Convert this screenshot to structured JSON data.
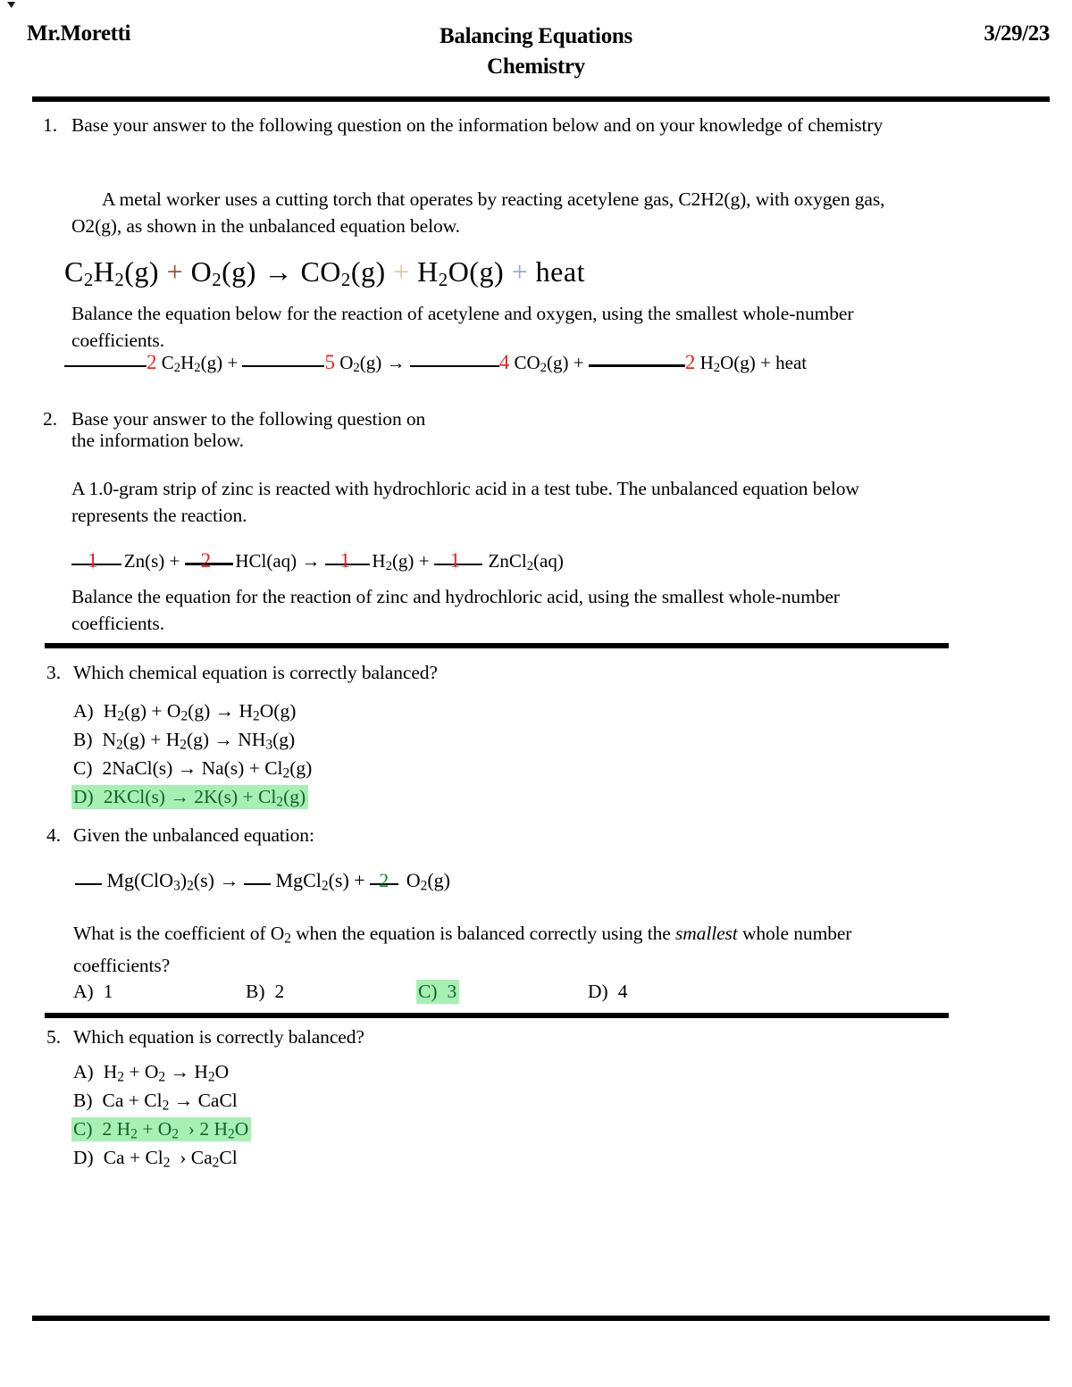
{
  "header": {
    "teacher": "Mr.Moretti",
    "title_line1": "Balancing Equations",
    "title_line2": "Chemistry",
    "date": "3/29/23"
  },
  "colors": {
    "highlight_green": "#a6f0b4",
    "highlight_text_green": "#13632a",
    "handwriting_red": "#e8221c",
    "handwriting_green": "#0a8a2a",
    "rule_black": "#000000"
  },
  "questions": [
    {
      "number": "1.",
      "stem": "Base your answer to the following question on the information below and on your knowledge of chemistry",
      "passage": "A metal worker uses a cutting torch that operates by reacting acetylene gas, C2H2(g), with oxygen gas, O2(g), as shown in the unbalanced equation below.",
      "display_equation": {
        "reactant1": "C2H2(g)",
        "plus1": "+",
        "reactant2": "O2(g)",
        "arrow": "→",
        "product1": "CO2(g)",
        "plus2": "+",
        "product2": "H2O(g)",
        "plus3": "+",
        "product3": "heat"
      },
      "instruction": "Balance the equation below for the reaction of acetylene and oxygen, using the smallest whole-number coefficients.",
      "fill_equation": {
        "terms": [
          {
            "answer": "2",
            "formula": "C2H2(g)"
          },
          {
            "answer": "5",
            "formula": "O2(g)"
          },
          {
            "answer": "4",
            "formula": "CO2(g)"
          },
          {
            "answer": "2",
            "formula": "H2O(g)"
          }
        ],
        "operator1": "+",
        "arrow": "→",
        "operator2": "+",
        "trailing": "+ heat"
      }
    },
    {
      "number": "2.",
      "stem_line1": "Base your answer to the following question on",
      "stem_line2": "the information below.",
      "passage": "A 1.0-gram strip of zinc is reacted with hydrochloric acid in a test tube. The unbalanced equation below represents the reaction.",
      "fill_equation": {
        "terms": [
          {
            "answer": "1",
            "formula": "Zn(s)"
          },
          {
            "answer": "2",
            "formula": "HCl(aq)"
          },
          {
            "answer": "1",
            "formula": "H2(g)"
          },
          {
            "answer": "1",
            "formula": "ZnCl2(aq)"
          }
        ],
        "operator1": "+",
        "arrow": "→",
        "operator2": "+"
      },
      "instruction": "Balance the equation for the reaction of zinc and hydrochloric acid, using the smallest whole-number coefficients."
    },
    {
      "number": "3.",
      "prompt": "Which chemical equation is correctly balanced?",
      "choices": [
        {
          "label": "A)",
          "text": "H2(g) + O2(g) → H2O(g)",
          "selected": false
        },
        {
          "label": "B)",
          "text": "N2(g) + H2(g) → NH3(g)",
          "selected": false
        },
        {
          "label": "C)",
          "text": "2NaCl(s) → Na(s) + Cl2(g)",
          "selected": false
        },
        {
          "label": "D)",
          "text": "2KCl(s) → 2K(s) + Cl2(g)",
          "selected": true
        }
      ]
    },
    {
      "number": "4.",
      "prompt": "Given the unbalanced equation:",
      "fill_equation": {
        "blank1": "",
        "reactant": "Mg(ClO3)2(s)",
        "arrow": "→",
        "blank2": "",
        "product1": "MgCl2(s)",
        "operator": "+",
        "answer": "2",
        "product2": "O2(g)"
      },
      "question_text_pre": "What is the coefficient of O",
      "question_text_sub": "2",
      "question_text_mid": " when the equation is balanced correctly using the ",
      "question_text_italic": "smallest",
      "question_text_post": " whole number coefficients?",
      "choices": [
        {
          "label": "A)",
          "text": "1",
          "selected": false
        },
        {
          "label": "B)",
          "text": "2",
          "selected": false
        },
        {
          "label": "C)",
          "text": "3",
          "selected": true
        },
        {
          "label": "D)",
          "text": "4",
          "selected": false
        }
      ]
    },
    {
      "number": "5.",
      "prompt": "Which equation is correctly balanced?",
      "choices": [
        {
          "label": "A)",
          "text": "H2 + O2 → H2O",
          "selected": false
        },
        {
          "label": "B)",
          "text": "Ca + Cl2 → CaCl",
          "selected": false
        },
        {
          "label": "C)",
          "text": "2 H2 + O2   › 2 H2O",
          "selected": true
        },
        {
          "label": "D)",
          "text": "Ca + Cl2   › Ca2Cl",
          "selected": false
        }
      ]
    }
  ]
}
